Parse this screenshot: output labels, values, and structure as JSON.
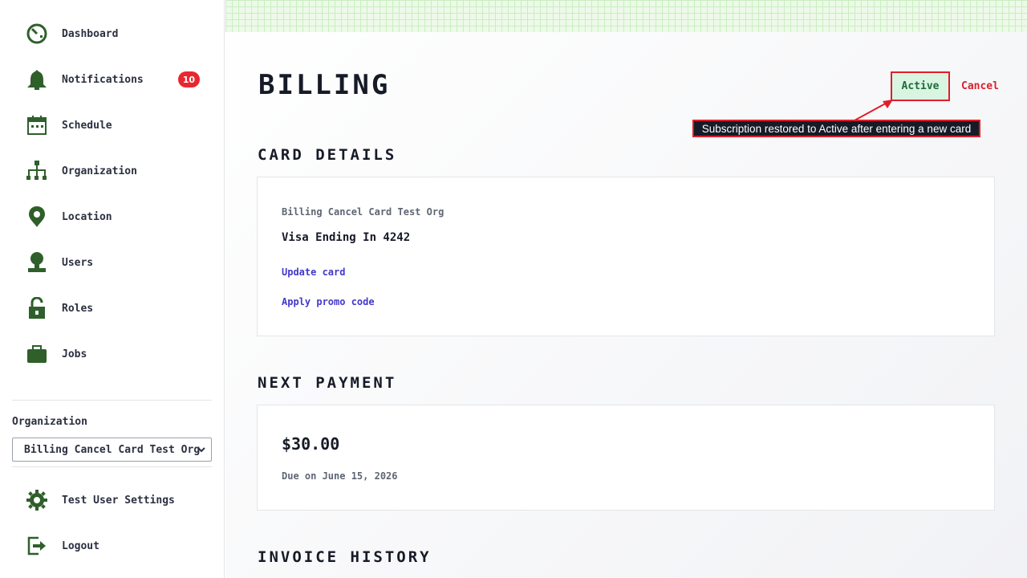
{
  "sidebar": {
    "items": [
      {
        "label": "Dashboard",
        "icon": "dashboard-icon"
      },
      {
        "label": "Notifications",
        "icon": "bell-icon",
        "badge": "10"
      },
      {
        "label": "Schedule",
        "icon": "calendar-icon"
      },
      {
        "label": "Organization",
        "icon": "org-chart-icon"
      },
      {
        "label": "Location",
        "icon": "location-pin-icon"
      },
      {
        "label": "Users",
        "icon": "user-icon"
      },
      {
        "label": "Roles",
        "icon": "padlock-icon"
      },
      {
        "label": "Jobs",
        "icon": "briefcase-icon"
      }
    ],
    "organization_label": "Organization",
    "organization_selected": "Billing Cancel Card Test Org",
    "settings_label": "Test User Settings",
    "logout_label": "Logout"
  },
  "header": {
    "title": "Billing",
    "status": "Active",
    "cancel_label": "Cancel",
    "callout": "Subscription restored to Active after entering a new card"
  },
  "card_details": {
    "section_title": "Card Details",
    "org_name": "Billing Cancel Card Test Org",
    "card_label": "Visa Ending In 4242",
    "update_card_label": "Update card",
    "promo_label": "Apply promo code"
  },
  "next_payment": {
    "section_title": "Next Payment",
    "amount": "$30.00",
    "due": "Due on June 15, 2026"
  },
  "invoice_history": {
    "section_title": "Invoice History"
  },
  "colors": {
    "accent_green": "#2f5f2a",
    "badge_red": "#e8272f",
    "link_indigo": "#4338ca",
    "status_bg": "#d9f5e2"
  }
}
